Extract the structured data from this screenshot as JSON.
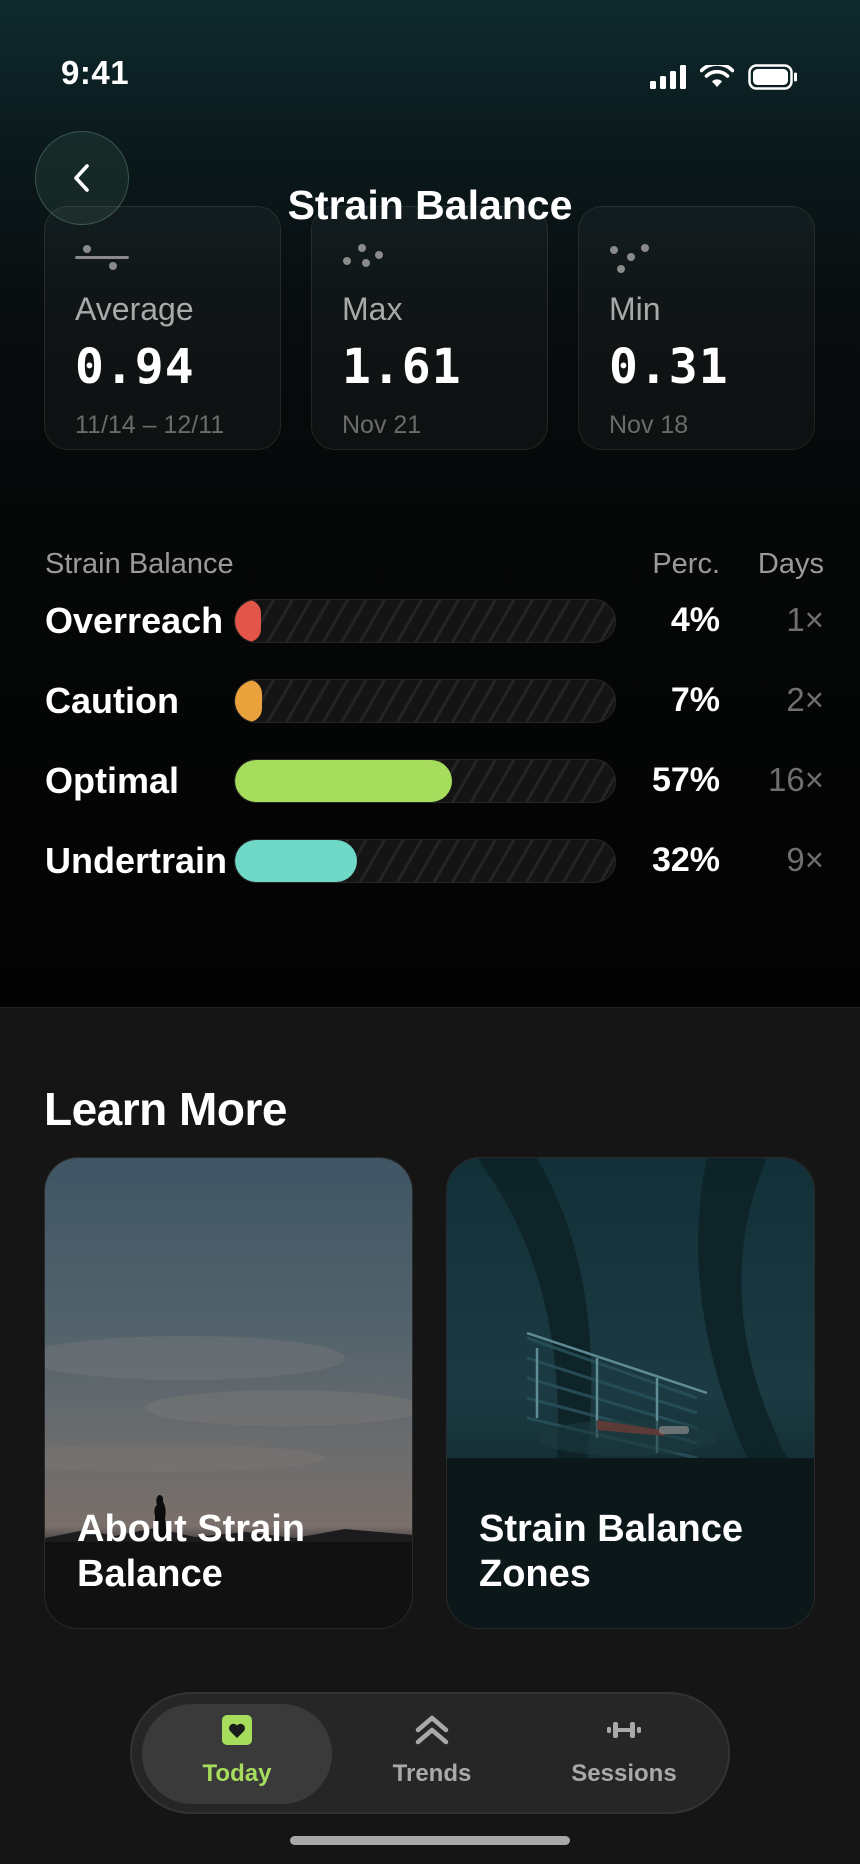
{
  "status_bar": {
    "time": "9:41"
  },
  "header": {
    "title": "Strain Balance"
  },
  "stats": [
    {
      "label": "Average",
      "value": "0.94",
      "sub": "11/14 – 12/11"
    },
    {
      "label": "Max",
      "value": "1.61",
      "sub": "Nov 21"
    },
    {
      "label": "Min",
      "value": "0.31",
      "sub": "Nov 18"
    }
  ],
  "strain_table": {
    "header_label": "Strain Balance",
    "header_perc": "Perc.",
    "header_days": "Days",
    "rows": [
      {
        "label": "Overreach",
        "perc": "4%",
        "days": "1×",
        "fraction": 0.04,
        "color": "#e25548"
      },
      {
        "label": "Caution",
        "perc": "7%",
        "days": "2×",
        "fraction": 0.07,
        "color": "#eaa23c"
      },
      {
        "label": "Optimal",
        "perc": "57%",
        "days": "16×",
        "fraction": 0.57,
        "color": "#a6dd5c"
      },
      {
        "label": "Undertrain",
        "perc": "32%",
        "days": "9×",
        "fraction": 0.32,
        "color": "#6fd8c7"
      }
    ]
  },
  "learn_more": {
    "title": "Learn More",
    "cards": [
      {
        "title": "About Strain Balance"
      },
      {
        "title": "Strain Balance Zones"
      }
    ]
  },
  "tab_bar": {
    "tabs": [
      {
        "label": "Today",
        "icon": "heart-icon",
        "active": true
      },
      {
        "label": "Trends",
        "icon": "chevrons-up-icon",
        "active": false
      },
      {
        "label": "Sessions",
        "icon": "dumbbell-icon",
        "active": false
      }
    ],
    "accent": "#a6dd5c"
  }
}
